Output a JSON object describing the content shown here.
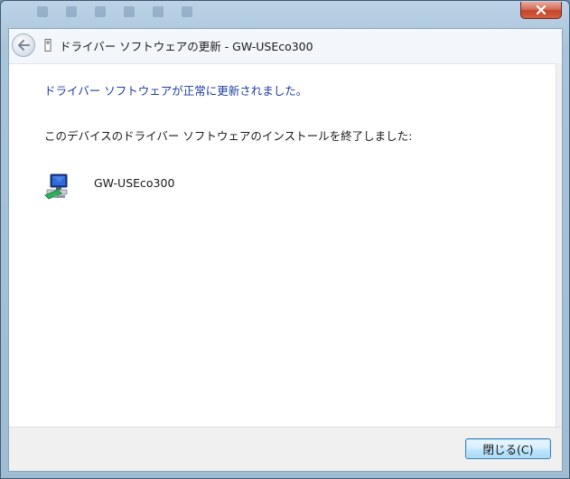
{
  "window": {
    "header_title": "ドライバー ソフトウェアの更新 - GW-USEco300",
    "title_buttons": [
      {
        "name": "close",
        "symbol": "✕"
      }
    ]
  },
  "main": {
    "success_message": "ドライバー ソフトウェアが正常に更新されました。",
    "completed_message": "このデバイスのドライバー ソフトウェアのインストールを終了しました:",
    "device": {
      "name": "GW-USEco300",
      "icon": "network-adapter-icon"
    }
  },
  "footer": {
    "close_button_label": "閉じる(C)"
  },
  "colors": {
    "accent_text": "#1f3f9e",
    "close_button": "#c5442a",
    "primary_button_border": "#3c7fb1"
  }
}
